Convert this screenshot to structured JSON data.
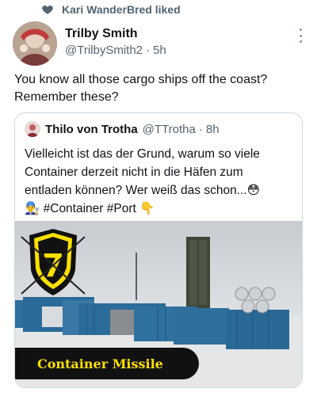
{
  "social_context": {
    "text": "Kari WanderBred liked",
    "icon": "heart-icon"
  },
  "tweet": {
    "author_name": "Trilby Smith",
    "author_handle": "@TrilbySmith2",
    "separator": "·",
    "time": "5h",
    "text_lines": [
      "You know all those cargo ships off the coast?",
      "Remember these?"
    ]
  },
  "quoted_tweet": {
    "author_name": "Thilo von Trotha",
    "author_handle": "@TTrotha",
    "separator": "·",
    "time": "8h",
    "text_lines": [
      "Vielleicht ist das der Grund, warum so viele",
      "Container derzeit nicht in die Häfen zum",
      "entladen können? Wer weiß das schon...😳"
    ],
    "emoji_person": "👨‍🔧",
    "hashtags": "#Container #Port",
    "emoji_hand": "👇",
    "media_caption": "Container Missile",
    "media_logo_number": "7"
  }
}
